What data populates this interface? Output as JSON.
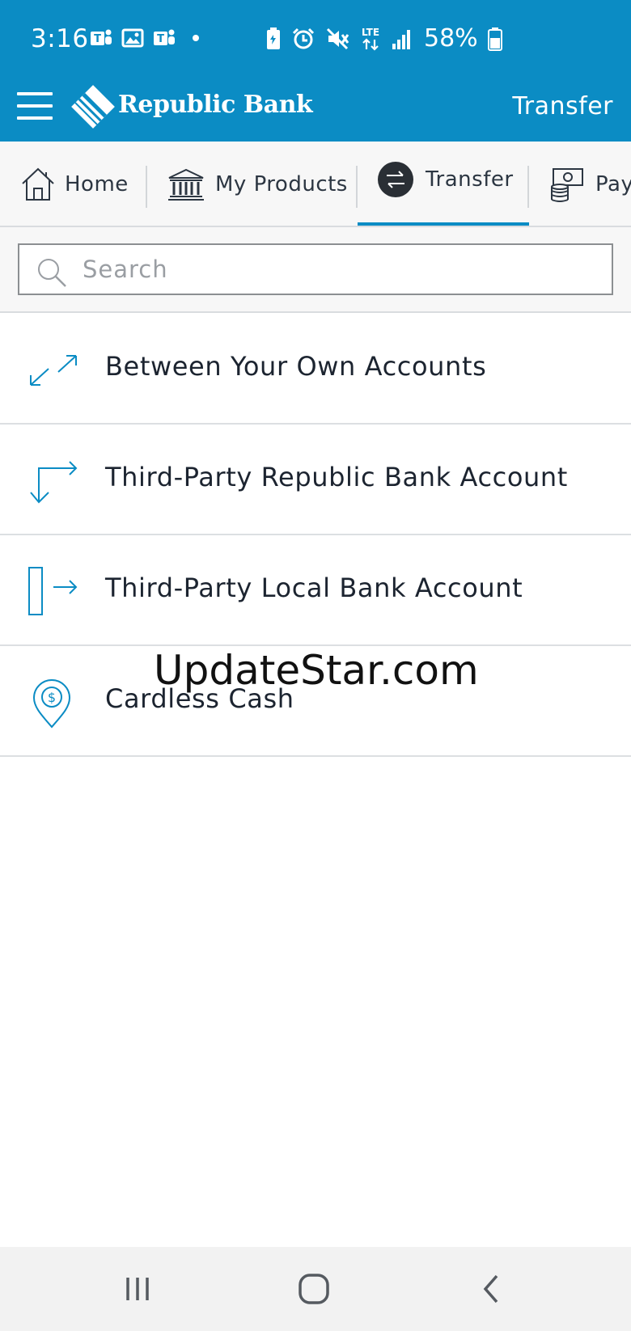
{
  "status_bar": {
    "time": "3:16",
    "left_icons": [
      "teams-icon",
      "gallery-icon",
      "teams-icon",
      "dot-icon"
    ],
    "right_icons": [
      "battery-saver-icon",
      "alarm-icon",
      "mute-icon",
      "lte-icon",
      "signal-icon"
    ],
    "network": "LTE",
    "battery_percent": "58%"
  },
  "header": {
    "brand_name": "Republic Bank",
    "title": "Transfer",
    "color": "#0b8cc4"
  },
  "tabs": [
    {
      "label": "Home",
      "icon": "home-icon",
      "active": false
    },
    {
      "label": "My Products",
      "icon": "bank-icon",
      "active": false
    },
    {
      "label": "Transfer",
      "icon": "transfer-icon",
      "active": true
    },
    {
      "label": "Pay",
      "icon": "pay-icon",
      "active": false
    }
  ],
  "search": {
    "placeholder": "Search",
    "value": ""
  },
  "transfer_options": [
    {
      "label": "Between Your Own Accounts",
      "icon": "expand-arrows-icon"
    },
    {
      "label": "Third-Party Republic Bank Account",
      "icon": "turn-arrow-icon"
    },
    {
      "label": "Third-Party Local Bank Account",
      "icon": "external-transfer-icon"
    },
    {
      "label": "Cardless Cash",
      "icon": "cash-pin-icon"
    }
  ],
  "watermark": "UpdateStar.com",
  "nav_bar": {
    "buttons": [
      "recents-icon",
      "home-button-icon",
      "back-icon"
    ]
  }
}
